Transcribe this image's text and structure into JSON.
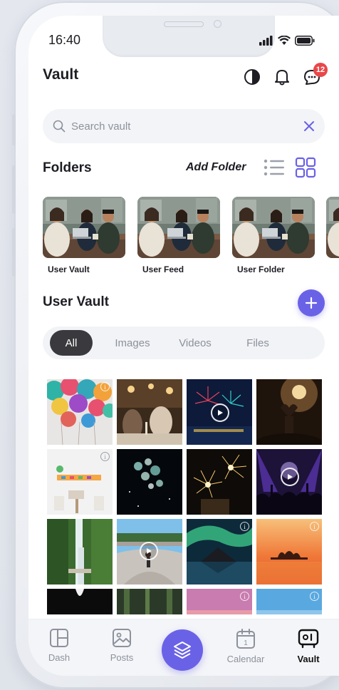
{
  "status": {
    "time": "16:40"
  },
  "header": {
    "title": "Vault",
    "notification_count": "12"
  },
  "search": {
    "placeholder": "Search vault"
  },
  "folders": {
    "title": "Folders",
    "add_label": "Add Folder",
    "items": [
      {
        "label": "User Vault"
      },
      {
        "label": "User Feed"
      },
      {
        "label": "User Folder"
      },
      {
        "label": ""
      }
    ]
  },
  "vault": {
    "title": "User Vault",
    "tabs": [
      {
        "label": "All",
        "active": true
      },
      {
        "label": "Images",
        "active": false
      },
      {
        "label": "Videos",
        "active": false
      },
      {
        "label": "Files",
        "active": false
      }
    ]
  },
  "gallery": {
    "items": [
      {
        "subject": "balloons",
        "type": "image"
      },
      {
        "subject": "restaurant-party",
        "type": "image"
      },
      {
        "subject": "fireworks-night",
        "type": "video"
      },
      {
        "subject": "concert-crowd-heart",
        "type": "image"
      },
      {
        "subject": "birthday-room",
        "type": "image"
      },
      {
        "subject": "bubbles-night",
        "type": "image"
      },
      {
        "subject": "sparklers",
        "type": "image"
      },
      {
        "subject": "concert-purple",
        "type": "video"
      },
      {
        "subject": "waterfall",
        "type": "image"
      },
      {
        "subject": "skatepark",
        "type": "video"
      },
      {
        "subject": "aurora",
        "type": "image"
      },
      {
        "subject": "sunset-island",
        "type": "image"
      },
      {
        "subject": "dark-cave",
        "type": "image"
      },
      {
        "subject": "forest",
        "type": "image"
      },
      {
        "subject": "pink-sky",
        "type": "image"
      },
      {
        "subject": "blue-sky",
        "type": "image"
      }
    ]
  },
  "nav": {
    "items": [
      {
        "label": "Dash",
        "icon": "dashboard-icon",
        "active": false
      },
      {
        "label": "Posts",
        "icon": "image-icon",
        "active": false
      },
      {
        "label": "",
        "icon": "layers-icon",
        "active": false
      },
      {
        "label": "Calendar",
        "icon": "calendar-icon",
        "active": false
      },
      {
        "label": "Vault",
        "icon": "vault-icon",
        "active": true
      }
    ]
  },
  "colors": {
    "accent": "#6a62e6",
    "badge": "#e8474a",
    "active_tab": "#3a3a3e"
  }
}
